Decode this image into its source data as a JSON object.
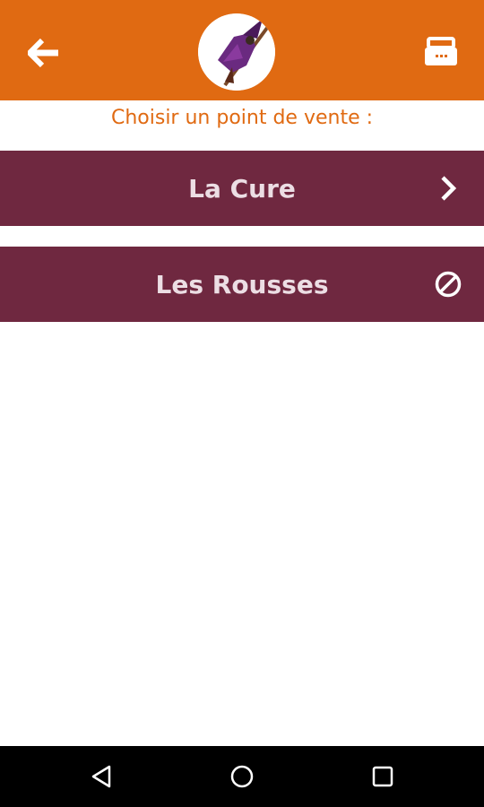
{
  "header": {
    "back_icon": "arrow-left-icon",
    "logo_icon": "witch-logo-icon",
    "cart_icon": "basket-icon"
  },
  "prompt": "Choisir un point de vente :",
  "stores": [
    {
      "label": "La Cure",
      "status_icon": "chevron-right-icon",
      "available": true
    },
    {
      "label": "Les Rousses",
      "status_icon": "block-icon",
      "available": false
    }
  ],
  "colors": {
    "header_bg": "#e06a12",
    "prompt_text": "#e06a12",
    "store_bg": "#6f2840",
    "store_text": "#ecdee4",
    "navbar_bg": "#000000"
  },
  "navbar": {
    "back_icon": "triangle-back-icon",
    "home_icon": "circle-home-icon",
    "recents_icon": "square-recents-icon"
  }
}
